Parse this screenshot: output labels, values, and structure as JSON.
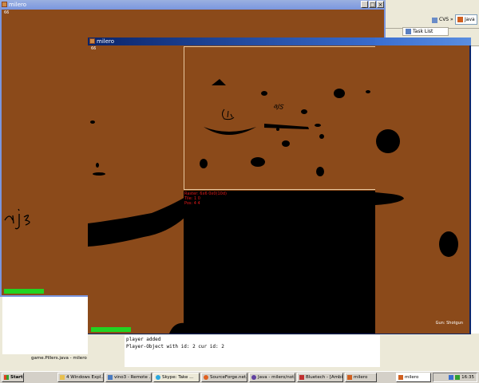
{
  "back_window": {
    "title": "milero",
    "fps": "66"
  },
  "front_window": {
    "title": "milero",
    "fps": "66",
    "gun_label": "Gun: Shotgun",
    "debug_lines": [
      "Raster: 6x6 0x0(10d)",
      "Tile: 1 0",
      "Pos: 4 4"
    ],
    "graffiti": "aJS",
    "health_fraction": 1
  },
  "back_graffiti": "aJS",
  "back_health_fraction": 1,
  "eclipse": {
    "task_list_tab": "Task List",
    "cvs_button": "CVS »",
    "java_button": "Java",
    "editor_tab": "game.Pillers.java - milero",
    "console_lines": [
      "player added",
      "Player-Object with id: 2 cur id: 2"
    ]
  },
  "taskbar": {
    "start": "Start",
    "items": [
      {
        "label": "4 Windows Expl...",
        "icon": "folder-icon",
        "color": "#e8c050"
      },
      {
        "label": "vino3 - Remote ...",
        "icon": "remote-icon",
        "color": "#4a7ac0"
      },
      {
        "label": "Skype: Take ...",
        "icon": "skype-icon",
        "color": "#2aa8e0"
      },
      {
        "label": "SourceForge.net...",
        "icon": "browser-icon",
        "color": "#e06020"
      },
      {
        "label": "Java - milero/not...",
        "icon": "eclipse-icon",
        "color": "#6040a0"
      },
      {
        "label": "Bluetech - [Ambie...",
        "icon": "app-icon",
        "color": "#c03030"
      },
      {
        "label": "milero",
        "icon": "java-icon",
        "color": "#d06020"
      }
    ],
    "tray_app": "milero",
    "clock": "16:35"
  }
}
